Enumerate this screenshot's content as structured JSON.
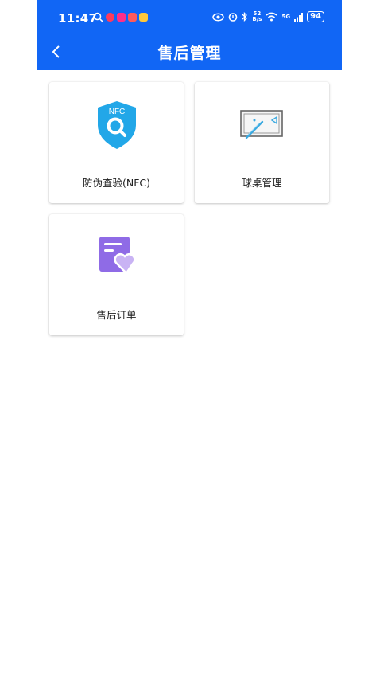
{
  "status_bar": {
    "time": "11:47",
    "net_speed": "52\nB/s",
    "signal": "5G",
    "battery": "94"
  },
  "header": {
    "title": "售后管理",
    "back_icon": "chevron-left-icon"
  },
  "colors": {
    "header_bg": "#1166f5",
    "shield": "#22a7e8",
    "order_purple": "#8f6be6",
    "order_heart": "#c9b3f4"
  },
  "menu": [
    {
      "label": "防伪查验(NFC)",
      "icon": "nfc-shield-icon",
      "icon_text": "NFC"
    },
    {
      "label": "球桌管理",
      "icon": "pool-table-icon"
    },
    {
      "label": "售后订单",
      "icon": "order-heart-icon"
    }
  ]
}
